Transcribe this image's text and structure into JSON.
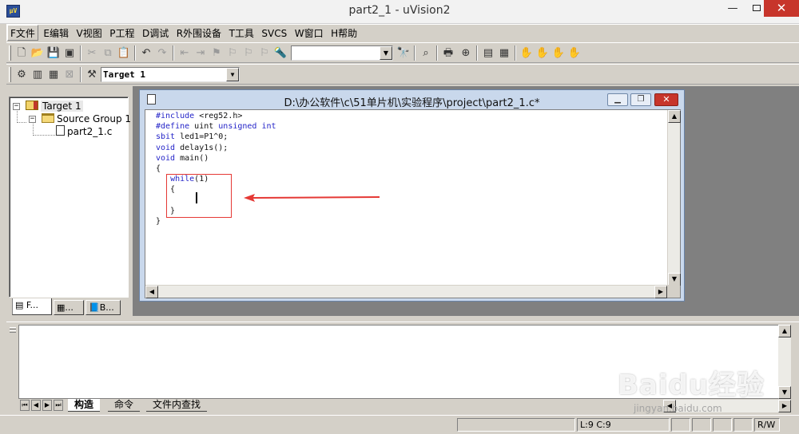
{
  "window": {
    "title": "part2_1  - uVision2",
    "app_icon_text": "μV"
  },
  "menu": [
    "F文件",
    "E编辑",
    "V视图",
    "P工程",
    "D调试",
    "R外围设备",
    "T工具",
    "SVCS",
    "W窗口",
    "H帮助"
  ],
  "toolbar": {
    "find_combo_value": "",
    "target_combo_value": "Target 1"
  },
  "project_tree": {
    "target": "Target 1",
    "group": "Source Group 1",
    "file": "part2_1.c"
  },
  "workspace_tabs": [
    "F...",
    "...",
    "B..."
  ],
  "editor": {
    "title": "D:\\办公软件\\c\\51单片机\\实验程序\\project\\part2_1.c*",
    "code_lines": [
      "#include <reg52.h>",
      "#define uint unsigned int",
      "sbit led1=P1^0;",
      "void delay1s();",
      "void main()",
      "{",
      "   while(1)",
      "   {",
      "",
      "   }",
      "}"
    ]
  },
  "output_tabs": [
    "构造",
    "命令",
    "文件内查找"
  ],
  "status": {
    "position": "L:9 C:9",
    "mode": "R/W"
  },
  "watermark": {
    "main": "Baidu经验",
    "sub": "jingyan.baidu.com"
  },
  "colors": {
    "keyword": "#2424c8",
    "highlight_box": "#e53935",
    "close_button": "#c7352b"
  }
}
